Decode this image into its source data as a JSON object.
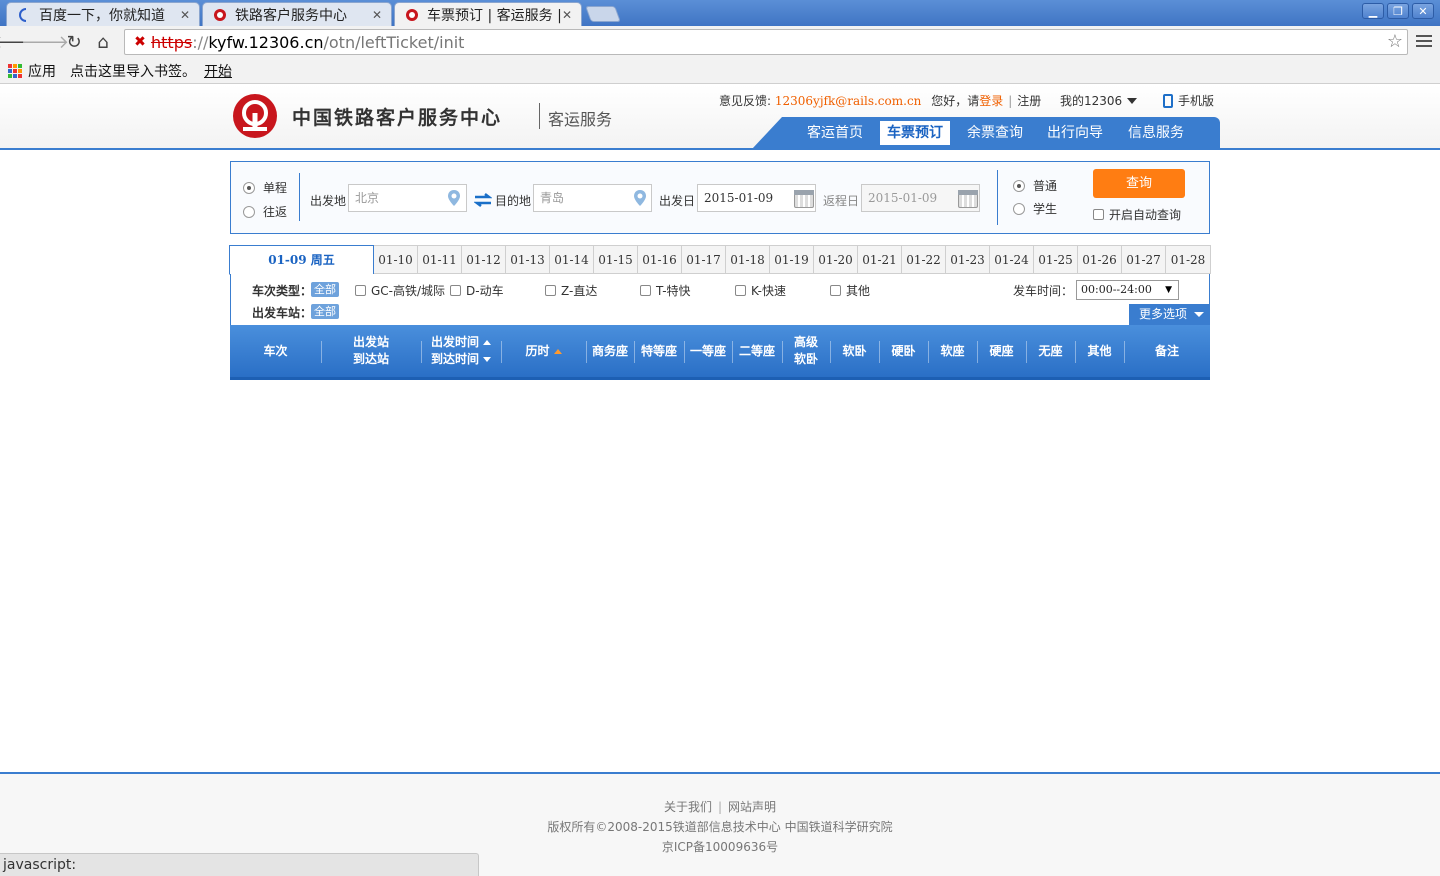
{
  "browser": {
    "tabs": [
      {
        "label": "百度一下，你就知道",
        "active": false
      },
      {
        "label": "铁路客户服务中心",
        "active": false
      },
      {
        "label": "车票预订 | 客运服务 |",
        "active": true
      }
    ],
    "url": {
      "scheme": "https",
      "sep": "://",
      "host": "kyfw.12306.cn",
      "path": "/otn/leftTicket/init"
    },
    "bookmarks": {
      "apps": "应用",
      "import_hint": "点击这里导入书签。",
      "start": "开始"
    },
    "status_text": "javascript:"
  },
  "header": {
    "site_title": "中国铁路客户服务中心",
    "site_subtitle": "客运服务",
    "feedback_label": "意见反馈:",
    "feedback_email": "12306yjfk@rails.com.cn",
    "greeting": "您好，请",
    "login": "登录",
    "register": "注册",
    "my12306": "我的12306",
    "mobile": "手机版",
    "nav": [
      "客运首页",
      "车票预订",
      "余票查询",
      "出行向导",
      "信息服务"
    ],
    "nav_active": 1
  },
  "search": {
    "trip_types": [
      "单程",
      "往返"
    ],
    "from_label": "出发地",
    "from_value": "北京",
    "to_label": "目的地",
    "to_value": "青岛",
    "depart_label": "出发日",
    "depart_value": "2015-01-09",
    "return_label": "返程日",
    "return_value": "2015-01-09",
    "passenger_types": [
      "普通",
      "学生"
    ],
    "query_button": "查询",
    "auto_query": "开启自动查询"
  },
  "dates": {
    "active": "01-09 周五",
    "list": [
      "01-10",
      "01-11",
      "01-12",
      "01-13",
      "01-14",
      "01-15",
      "01-16",
      "01-17",
      "01-18",
      "01-19",
      "01-20",
      "01-21",
      "01-22",
      "01-23",
      "01-24",
      "01-25",
      "01-26",
      "01-27",
      "01-28"
    ]
  },
  "filters": {
    "train_type_label": "车次类型：",
    "station_label": "出发车站：",
    "all_tag": "全部",
    "train_types": [
      "GC-高铁/城际",
      "D-动车",
      "Z-直达",
      "T-特快",
      "K-快速",
      "其他"
    ],
    "depart_time_label": "发车时间：",
    "depart_time_value": "00:00--24:00",
    "more_options": "更多选项"
  },
  "result_columns": {
    "train": "车次",
    "from_station": "出发站",
    "to_station": "到达站",
    "depart_time": "出发时间",
    "arrive_time": "到达时间",
    "duration": "历时",
    "business": "商务座",
    "special": "特等座",
    "first": "一等座",
    "second": "二等座",
    "premium_soft_1": "高级",
    "premium_soft_2": "软卧",
    "soft_sleeper": "软卧",
    "hard_sleeper": "硬卧",
    "soft_seat": "软座",
    "hard_seat": "硬座",
    "no_seat": "无座",
    "other": "其他",
    "remark": "备注"
  },
  "footer": {
    "about": "关于我们",
    "statement": "网站声明",
    "copyright": "版权所有©2008-2015铁道部信息技术中心  中国铁道科学研究院",
    "icp": "京ICP备10009636号"
  }
}
